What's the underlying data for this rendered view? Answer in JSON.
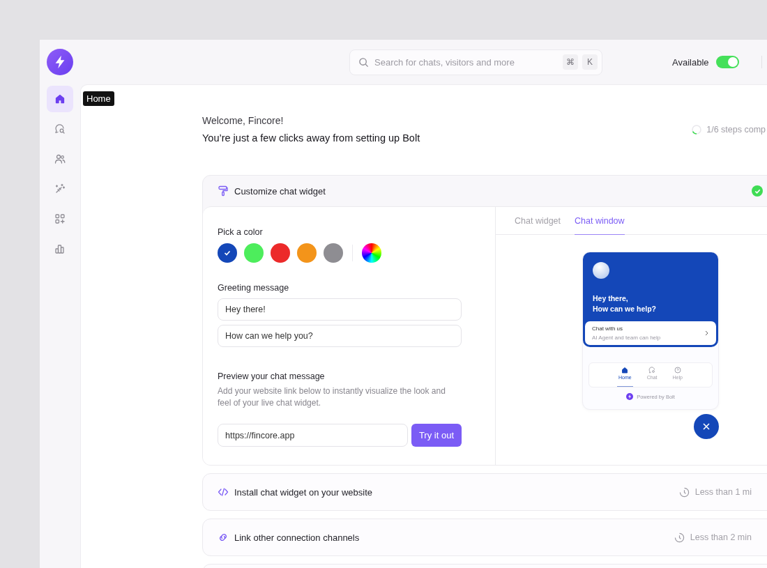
{
  "sidebar": {
    "items": [
      {
        "kind": "home",
        "selected": true,
        "tooltip": "Home"
      },
      {
        "kind": "chat-search",
        "selected": false
      },
      {
        "kind": "users",
        "selected": false
      },
      {
        "kind": "magic",
        "selected": false
      },
      {
        "kind": "apps",
        "selected": false
      },
      {
        "kind": "chart",
        "selected": false
      }
    ]
  },
  "topbar": {
    "search": {
      "placeholder": "Search for chats, visitors and more",
      "shortcut_keys": [
        "⌘",
        "K"
      ]
    },
    "status": {
      "label": "Available",
      "on": true
    }
  },
  "welcome": {
    "greeting": "Welcome, Fincore!",
    "subtitle": "You’re just a few clicks away from setting up Bolt",
    "progress": {
      "label": "1/6 steps comp",
      "level": 0.17
    }
  },
  "steps": [
    {
      "kind": "paint",
      "title": "Customize chat widget",
      "expanded": true,
      "completed": true
    },
    {
      "kind": "code",
      "title": "Install chat widget on your website",
      "expanded": false,
      "completed": false,
      "duration": "Less than 1 mi"
    },
    {
      "kind": "link",
      "title": "Link other connection channels",
      "expanded": false,
      "completed": false,
      "duration": "Less than 2 min"
    }
  ],
  "customize": {
    "color_label": "Pick a color",
    "colors": [
      {
        "color": "#1447b8",
        "selected": true
      },
      {
        "color": "#4ded5c",
        "selected": false
      },
      {
        "color": "#ec2a2a",
        "selected": false
      },
      {
        "color": "#f3941a",
        "selected": false
      },
      {
        "color": "#8e8d92",
        "selected": false
      }
    ],
    "greeting_label": "Greeting message",
    "greeting_lines": [
      "Hey there!",
      "How can we help you?"
    ],
    "preview_label": "Preview your chat message",
    "preview_text": "Add your website link below to instantly visualize the look and feel of your live chat widget.",
    "url": "https://fincore.app",
    "button": "Try it out"
  },
  "preview": {
    "tabs": [
      {
        "label": "Chat widget",
        "selected": false
      },
      {
        "label": "Chat window",
        "selected": true
      }
    ],
    "widget": {
      "heading_lines": [
        "Hey there,",
        "How can we help?"
      ],
      "card_title": "Chat with us",
      "card_subtitle": "AI Agent and team can help",
      "nav": [
        {
          "kind": "home",
          "label": "Home",
          "selected": true
        },
        {
          "kind": "chat",
          "label": "Chat",
          "selected": false
        },
        {
          "kind": "help",
          "label": "Help",
          "selected": false
        }
      ],
      "powered_by": "Powered by Bolt"
    }
  }
}
